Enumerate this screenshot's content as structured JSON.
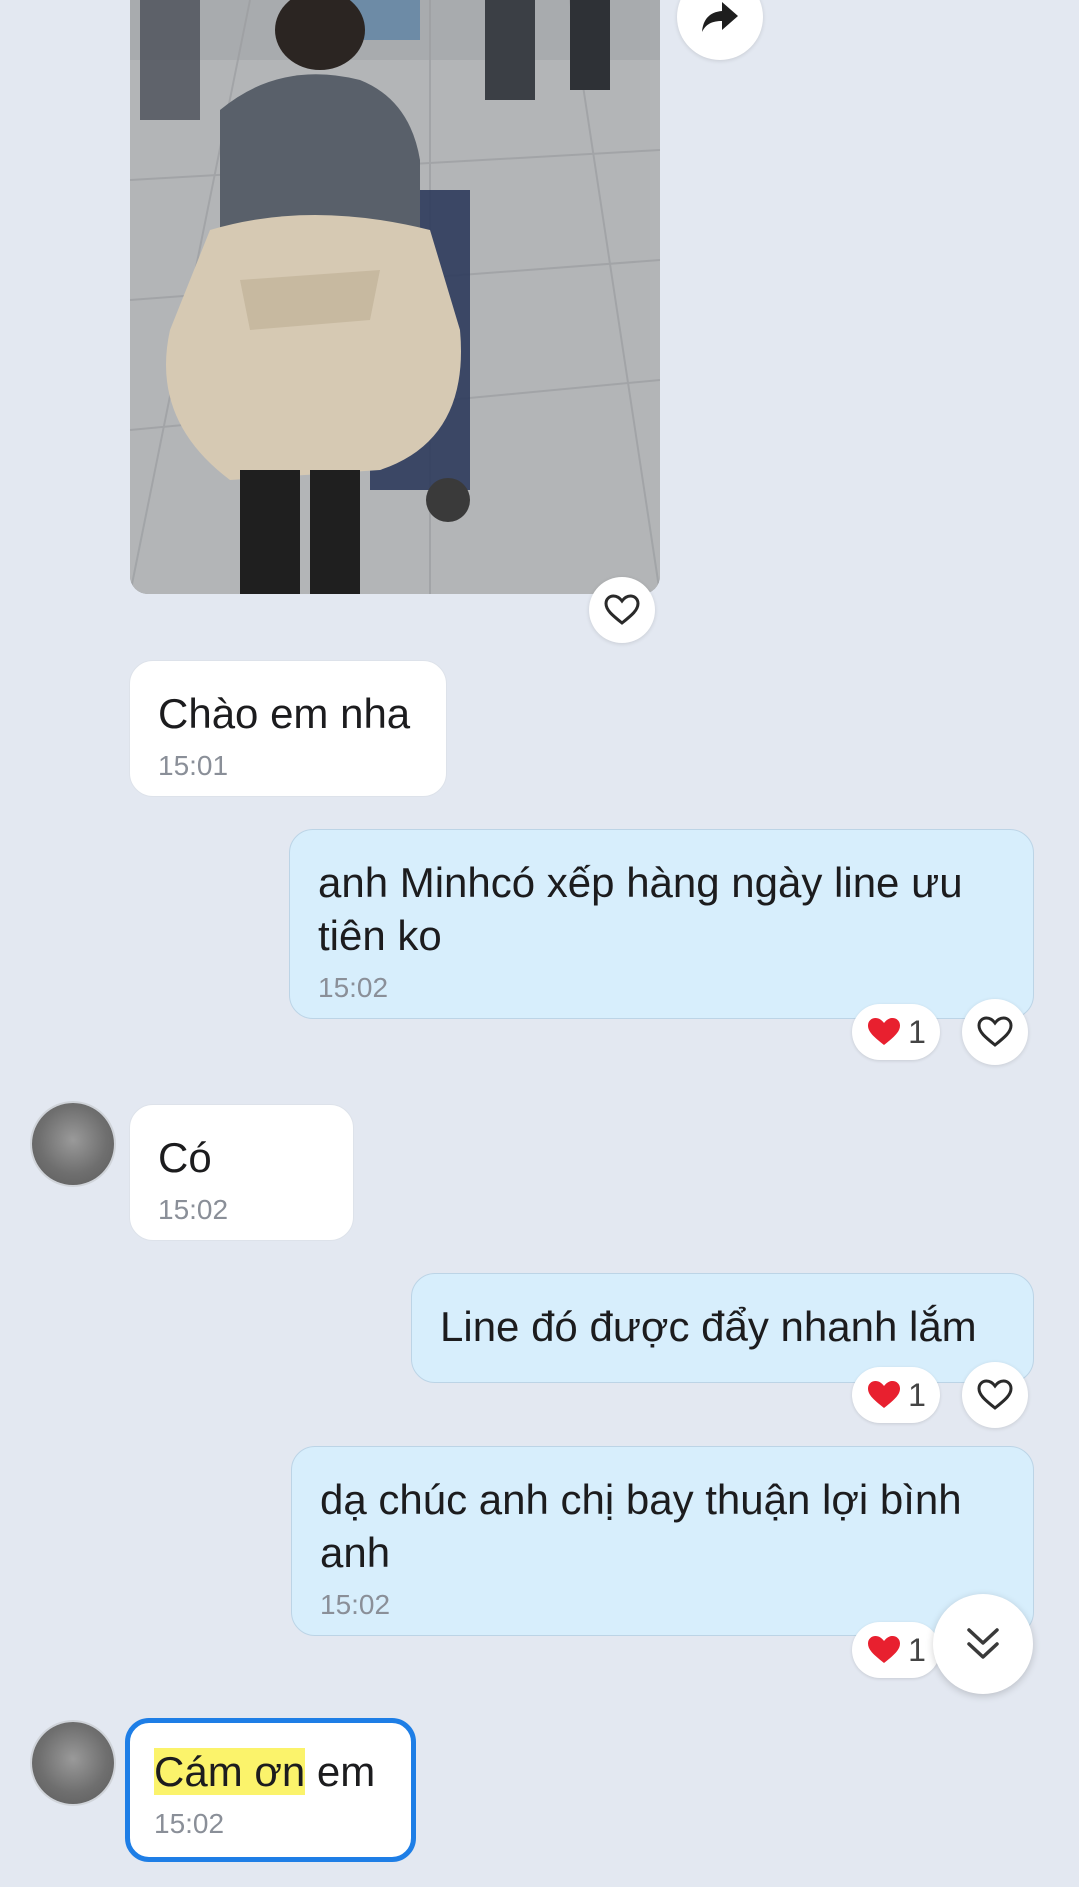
{
  "photo": {
    "alt_icon": "photo-of-traveler-with-luggage-cart"
  },
  "icons": {
    "share": "share-arrow-icon",
    "heart_outline": "heart-outline-icon",
    "heart_filled": "red-heart-icon",
    "scroll_down": "double-chevron-down-icon"
  },
  "messages": [
    {
      "id": "m1",
      "direction": "incoming",
      "text": "Chào em nha",
      "time": "15:01"
    },
    {
      "id": "m2",
      "direction": "outgoing",
      "text": "anh Minhcó xếp hàng ngày line ưu tiên ko",
      "time": "15:02",
      "reaction_count": "1"
    },
    {
      "id": "m3",
      "direction": "incoming",
      "text": "Có",
      "time": "15:02"
    },
    {
      "id": "m4",
      "direction": "outgoing",
      "text": "Line đó được đẩy nhanh lắm",
      "reaction_count": "1"
    },
    {
      "id": "m5",
      "direction": "outgoing",
      "text": "dạ chúc anh chị bay thuận lợi bình anh",
      "time": "15:02",
      "reaction_count": "1"
    },
    {
      "id": "m6",
      "direction": "incoming",
      "text_highlight": "Cám ơn",
      "text_rest": " em",
      "time": "15:02",
      "selected": true
    }
  ],
  "colors": {
    "background": "#e3e8f1",
    "incoming_bubble": "#ffffff",
    "outgoing_bubble": "#d7eefc",
    "selection_border": "#1e7ee6",
    "highlight": "#fbf36b",
    "heart_red": "#e8202f"
  }
}
